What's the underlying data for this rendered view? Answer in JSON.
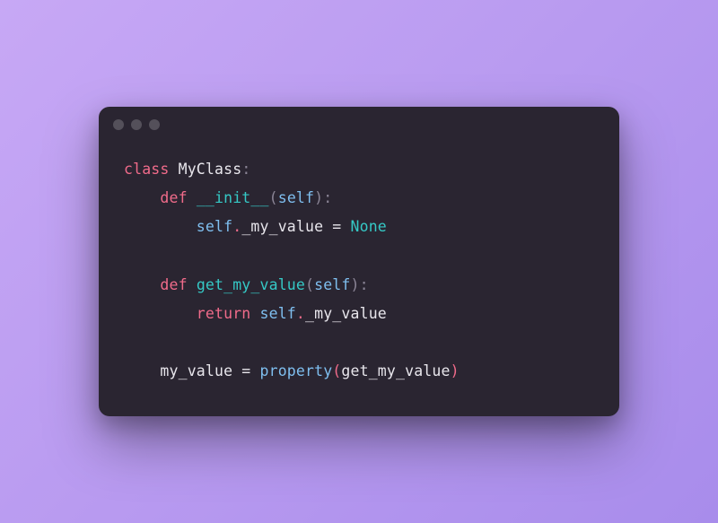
{
  "code": {
    "line1": {
      "kw": "class",
      "name": "MyClass",
      "colon": ":"
    },
    "line2": {
      "kw": "def",
      "fn": "__init__",
      "lp": "(",
      "self": "self",
      "rp": ")",
      "colon": ":"
    },
    "line3": {
      "self": "self",
      "dot": ".",
      "attr": "_my_value",
      "eq": " = ",
      "none": "None"
    },
    "line5": {
      "kw": "def",
      "fn": "get_my_value",
      "lp": "(",
      "self": "self",
      "rp": ")",
      "colon": ":"
    },
    "line6": {
      "kw": "return",
      "self": "self",
      "dot": ".",
      "attr": "_my_value"
    },
    "line8": {
      "name": "my_value",
      "eq": " = ",
      "prop": "property",
      "lp": "(",
      "arg": "get_my_value",
      "rp": ")"
    }
  }
}
